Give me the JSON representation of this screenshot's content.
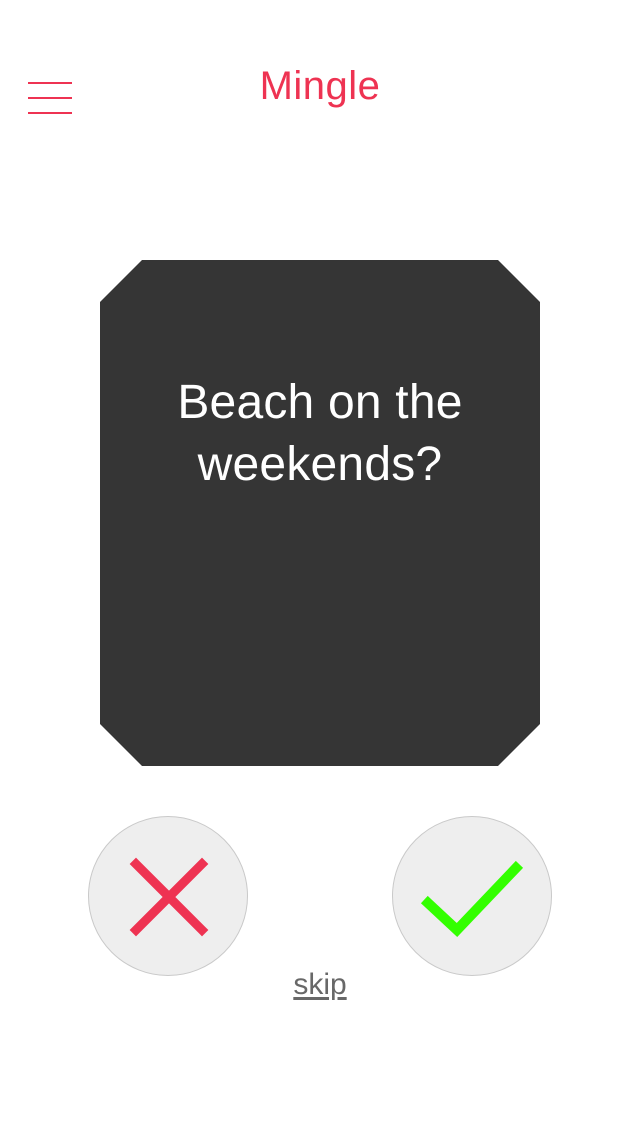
{
  "header": {
    "title": "Mingle",
    "menu_icon": "hamburger-menu-icon"
  },
  "question": {
    "text": "Beach on the weekends?"
  },
  "actions": {
    "reject_icon": "close-icon",
    "accept_icon": "check-icon",
    "skip_label": "skip"
  },
  "colors": {
    "brand": "#ee3352",
    "card_background": "#353535",
    "question_text": "#ffffff",
    "button_background": "#eeeeee",
    "button_border": "#c9c9c9",
    "reject": "#ee3352",
    "accept": "#33ff00",
    "skip": "#686868"
  }
}
